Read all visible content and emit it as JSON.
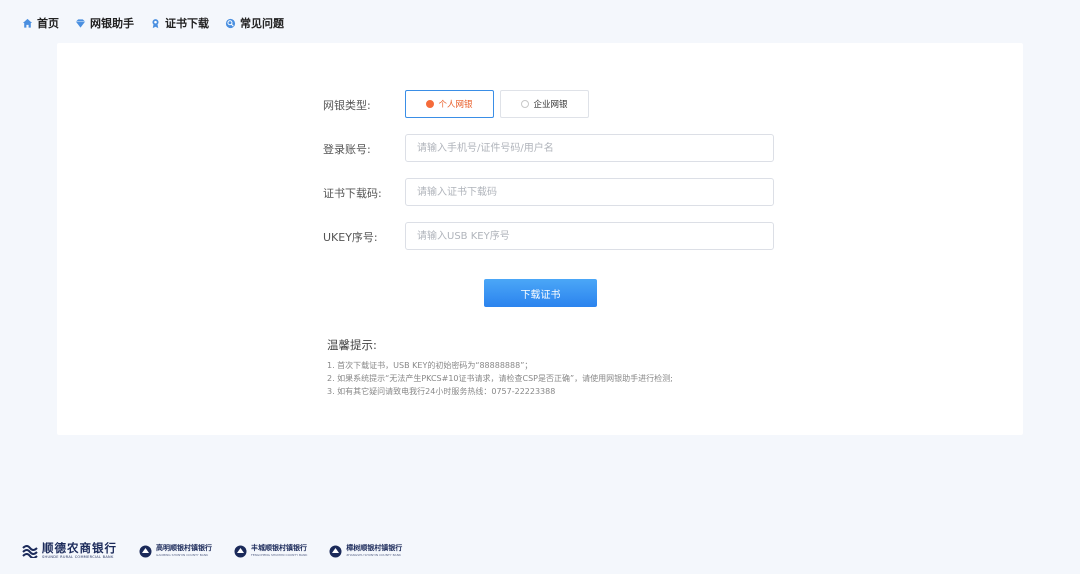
{
  "nav": {
    "items": [
      {
        "label": "首页",
        "icon": "home-icon"
      },
      {
        "label": "网银助手",
        "icon": "diamond-icon"
      },
      {
        "label": "证书下载",
        "icon": "certificate-icon"
      },
      {
        "label": "常见问题",
        "icon": "question-icon"
      }
    ],
    "icon_color": "#4a8fe0"
  },
  "form": {
    "type_label": "网银类型:",
    "type_options": [
      {
        "label": "个人网银",
        "selected": true
      },
      {
        "label": "企业网银",
        "selected": false
      }
    ],
    "account_label": "登录账号:",
    "account_placeholder": "请输入手机号/证件号码/用户名",
    "code_label": "证书下载码:",
    "code_placeholder": "请输入证书下载码",
    "ukey_label": "UKEY序号:",
    "ukey_placeholder": "请输入USB KEY序号",
    "submit_label": "下载证书"
  },
  "tips": {
    "title": "温馨提示:",
    "items": [
      "1. 首次下载证书，USB KEY的初始密码为“88888888”；",
      "2. 如果系统提示“无法产生PKCS#10证书请求，请检查CSP是否正确”，请使用网银助手进行检测;",
      "3. 如有其它疑问请致电我行24小时服务热线：0757-22223388"
    ]
  },
  "footer": {
    "logos": [
      {
        "name": "顺德农商银行",
        "en": "SHUNDE RURAL COMMERCIAL BANK",
        "type": "main"
      },
      {
        "name": "高明顺银村镇银行",
        "en": "GAOMING SHUNYIN COUNTY BANK",
        "type": "sub"
      },
      {
        "name": "丰城顺银村镇银行",
        "en": "FENGCHENG SHUNYIN COUNTY BANK",
        "type": "sub"
      },
      {
        "name": "樟树顺银村镇银行",
        "en": "ZHANGSHU SHUNYIN COUNTY BANK",
        "type": "sub"
      }
    ]
  },
  "colors": {
    "background": "#f4f7fc",
    "card": "#ffffff",
    "primary": "#2b83ee",
    "accent": "#e85a23",
    "brand": "#1b2a5a"
  }
}
